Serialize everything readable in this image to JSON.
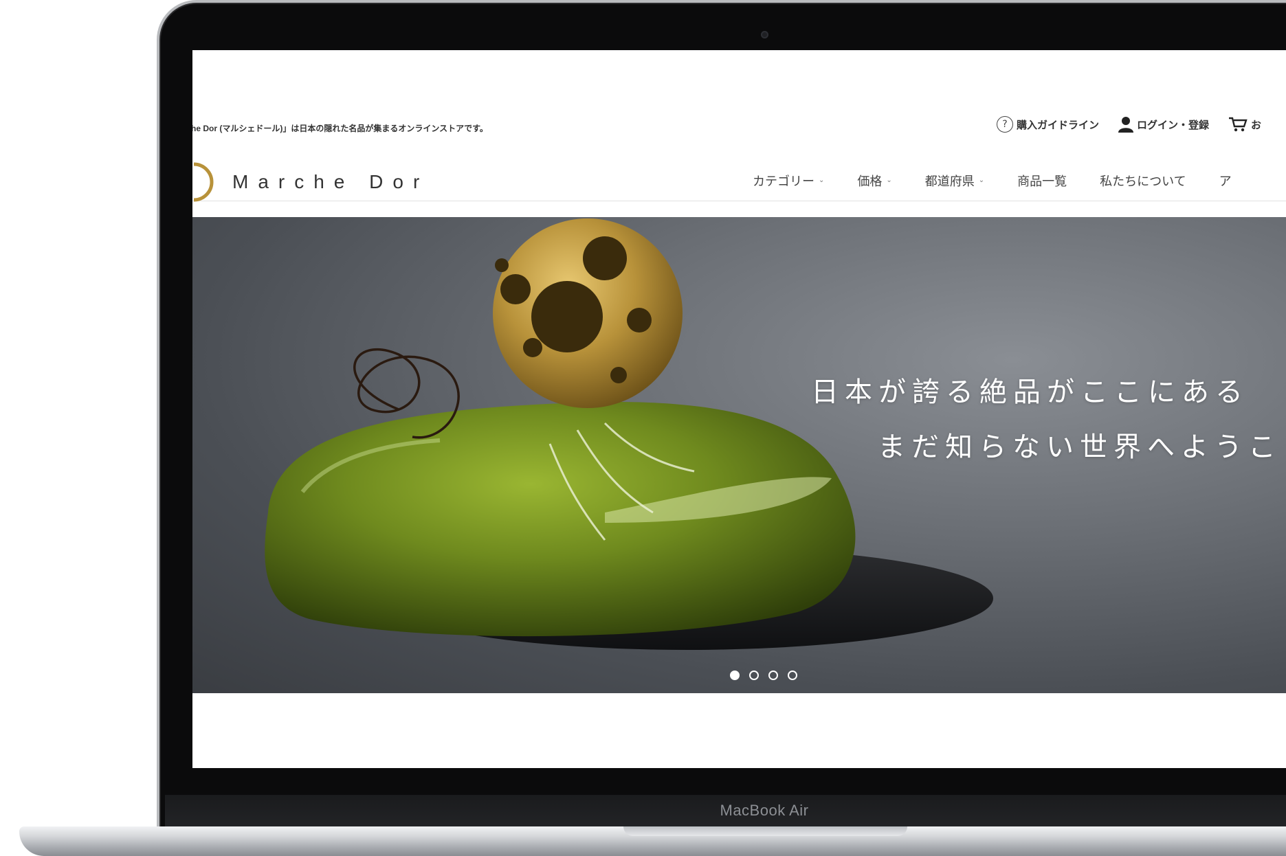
{
  "topbar": {
    "tagline": "he Dor (マルシェドール)」は日本の隠れた名品が集まるオンラインストアです。",
    "links": {
      "guide": "購入ガイドライン",
      "login": "ログイン・登録",
      "cart": "お"
    }
  },
  "header": {
    "logo_text": "Marche Dor",
    "nav": [
      {
        "label": "カテゴリー",
        "dropdown": true
      },
      {
        "label": "価格",
        "dropdown": true
      },
      {
        "label": "都道府県",
        "dropdown": true
      },
      {
        "label": "商品一覧",
        "dropdown": false
      },
      {
        "label": "私たちについて",
        "dropdown": false
      },
      {
        "label": "ア",
        "dropdown": false
      }
    ]
  },
  "hero": {
    "line1": "日本が誇る絶品がここにある",
    "line2": "まだ知らない世界へようこ",
    "slide_count": 4,
    "active_slide": 1
  },
  "device": {
    "brand": "MacBook Air"
  },
  "colors": {
    "accent_gold": "#b8923a",
    "dessert_green": "#6f8a1e",
    "hero_bg": "#5e6268"
  }
}
